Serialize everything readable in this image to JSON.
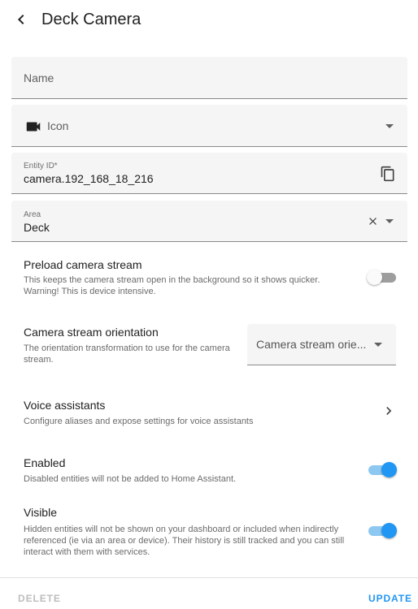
{
  "header": {
    "title": "Deck Camera",
    "back_icon": "chevron-left-icon"
  },
  "form": {
    "name": {
      "placeholder": "Name"
    },
    "icon": {
      "placeholder": "Icon",
      "icon": "video-camera-icon"
    },
    "entity_id": {
      "label": "Entity ID*",
      "value": "camera.192_168_18_216",
      "icon": "copy-icon"
    },
    "area": {
      "label": "Area",
      "value": "Deck",
      "clear_icon": "close-icon"
    }
  },
  "preload": {
    "title": "Preload camera stream",
    "description": "This keeps the camera stream open in the background so it shows quicker. Warning! This is device intensive.",
    "enabled": false
  },
  "orientation": {
    "title": "Camera stream orientation",
    "description": "The orientation transformation to use for the camera stream.",
    "select_value": "Camera stream orie..."
  },
  "voice": {
    "title": "Voice assistants",
    "description": "Configure aliases and expose settings for voice assistants"
  },
  "enabled": {
    "title": "Enabled",
    "description": "Disabled entities will not be added to Home Assistant.",
    "enabled": true
  },
  "visible": {
    "title": "Visible",
    "description": "Hidden entities will not be shown on your dashboard or included when indirectly referenced (ie via an area or device). Their history is still tracked and you can still interact with them with services.",
    "enabled": true
  },
  "footer": {
    "delete_label": "DELETE",
    "update_label": "UPDATE"
  },
  "colors": {
    "accent": "#2196f3",
    "disabled": "#bdbdbd",
    "field_bg": "#f5f5f5"
  }
}
